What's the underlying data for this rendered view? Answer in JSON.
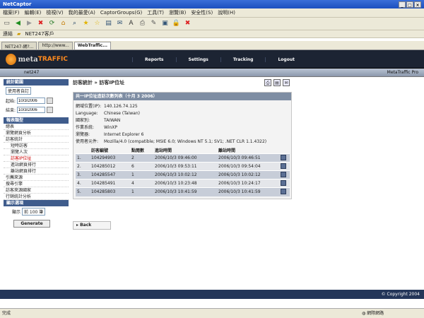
{
  "window": {
    "title": "NetCaptor"
  },
  "menu": [
    "檔案(F)",
    "編輯(E)",
    "檢視(V)",
    "我的最愛(A)",
    "CaptorGroups(G)",
    "工具(T)",
    "瀏覽(B)",
    "安全性(S)",
    "說明(H)"
  ],
  "links": {
    "label": "連結",
    "item": "NET247客戶"
  },
  "tabs": [
    "NET247-網?...",
    "http://www...",
    "WebTraffic..."
  ],
  "header": {
    "nav": [
      "Reports",
      "Settings",
      "Tracking",
      "Logout"
    ]
  },
  "subheader": {
    "left": "net247",
    "right": "MetaTraffic Pro"
  },
  "sidebar": {
    "stats_range": "統計範圍",
    "range_select": "使用者自訂",
    "start_label": "起始:",
    "start_value": "10/3/2006",
    "end_label": "結束:",
    "end_value": "10/3/2006",
    "report_type": "報表類型",
    "items": [
      {
        "label": "總表",
        "level": 0
      },
      {
        "label": "瀏覽網頁分析",
        "level": 0
      },
      {
        "label": "訪客統計",
        "level": 0
      },
      {
        "label": "短時訪客",
        "level": 1
      },
      {
        "label": "瀏覽人次",
        "level": 1
      },
      {
        "label": "訪客IP位址",
        "level": 1,
        "active": true
      },
      {
        "label": "進站網頁排行",
        "level": 1
      },
      {
        "label": "離站網頁排行",
        "level": 1
      },
      {
        "label": "引薦來源",
        "level": 0
      },
      {
        "label": "搜尋引擎",
        "level": 0
      },
      {
        "label": "訪客來源國家",
        "level": 0
      },
      {
        "label": "行銷統計分析",
        "level": 0
      }
    ],
    "display_options": "顯示選項",
    "show_label": "顯示",
    "show_value": "前 100 筆",
    "generate": "Generate"
  },
  "main": {
    "breadcrumb": "訪客統計 » 訪客IP位址",
    "panel_title": "共一IP位址造訪次數列表（十月 3 2006）",
    "info": [
      {
        "k": "網域位置(IP):",
        "v": "140.126.74.125"
      },
      {
        "k": "Language:",
        "v": "Chinese (Taiwan)"
      },
      {
        "k": "國家別:",
        "v": "TAIWAN"
      },
      {
        "k": "作業系統:",
        "v": "WinXP"
      },
      {
        "k": "瀏覽器:",
        "v": "Internet Explorer 6"
      },
      {
        "k": "使用者元件:",
        "v": "Mozilla/4.0 (compatible; MSIE 6.0; Windows NT 5.1; SV1; .NET CLR 1.1.4322)"
      }
    ],
    "table": {
      "headers": [
        "",
        "訪客編號",
        "點閱數",
        "進站時間",
        "離站時間",
        ""
      ],
      "rows": [
        [
          "1.",
          "104294903",
          "2",
          "2006/10/3 09:46:00",
          "2006/10/3 09:46:51"
        ],
        [
          "2.",
          "104285012",
          "6",
          "2006/10/3 09:53:11",
          "2006/10/3 09:54:04"
        ],
        [
          "3.",
          "104285547",
          "1",
          "2006/10/3 10:02:12",
          "2006/10/3 10:02:12"
        ],
        [
          "4.",
          "104285491",
          "4",
          "2006/10/3 10:23:48",
          "2006/10/3 10:24:17"
        ],
        [
          "5.",
          "104285803",
          "1",
          "2006/10/3 10:41:59",
          "2006/10/3 10:41:59"
        ]
      ]
    },
    "back": "Back"
  },
  "footer": "© Copyright 2004",
  "status": {
    "left": "完成",
    "zone": "網際網路"
  }
}
